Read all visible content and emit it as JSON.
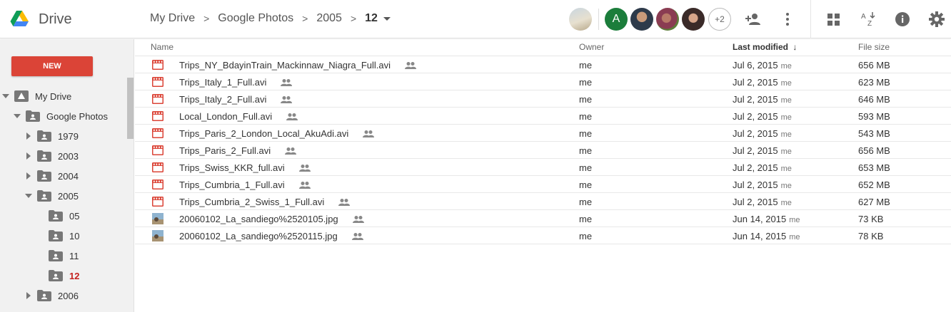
{
  "app": {
    "name": "Drive"
  },
  "breadcrumb": [
    "My Drive",
    "Google Photos",
    "2005",
    "12"
  ],
  "collaborators": {
    "letter": "A",
    "more": "+2"
  },
  "sidebar": {
    "new_label": "NEW",
    "tree": [
      {
        "label": "My Drive",
        "level": 0,
        "expanded": true,
        "type": "drive"
      },
      {
        "label": "Google Photos",
        "level": 1,
        "expanded": true,
        "type": "shared"
      },
      {
        "label": "1979",
        "level": 2,
        "expanded": false,
        "type": "shared"
      },
      {
        "label": "2003",
        "level": 2,
        "expanded": false,
        "type": "shared"
      },
      {
        "label": "2004",
        "level": 2,
        "expanded": false,
        "type": "shared"
      },
      {
        "label": "2005",
        "level": 2,
        "expanded": true,
        "type": "shared"
      },
      {
        "label": "05",
        "level": 3,
        "expanded": null,
        "type": "shared"
      },
      {
        "label": "10",
        "level": 3,
        "expanded": null,
        "type": "shared"
      },
      {
        "label": "11",
        "level": 3,
        "expanded": null,
        "type": "shared"
      },
      {
        "label": "12",
        "level": 3,
        "expanded": null,
        "type": "shared",
        "active": true
      },
      {
        "label": "2006",
        "level": 2,
        "expanded": false,
        "type": "shared"
      }
    ]
  },
  "columns": {
    "name": "Name",
    "owner": "Owner",
    "modified": "Last modified",
    "sort_arrow": "↓",
    "size": "File size"
  },
  "files": [
    {
      "name": "Trips_NY_BdayinTrain_Mackinnaw_Niagra_Full.avi",
      "type": "video",
      "owner": "me",
      "modified": "Jul 6, 2015",
      "modified_by": "me",
      "size": "656 MB"
    },
    {
      "name": "Trips_Italy_1_Full.avi",
      "type": "video",
      "owner": "me",
      "modified": "Jul 2, 2015",
      "modified_by": "me",
      "size": "623 MB"
    },
    {
      "name": "Trips_Italy_2_Full.avi",
      "type": "video",
      "owner": "me",
      "modified": "Jul 2, 2015",
      "modified_by": "me",
      "size": "646 MB"
    },
    {
      "name": "Local_London_Full.avi",
      "type": "video",
      "owner": "me",
      "modified": "Jul 2, 2015",
      "modified_by": "me",
      "size": "593 MB"
    },
    {
      "name": "Trips_Paris_2_London_Local_AkuAdi.avi",
      "type": "video",
      "owner": "me",
      "modified": "Jul 2, 2015",
      "modified_by": "me",
      "size": "543 MB"
    },
    {
      "name": "Trips_Paris_2_Full.avi",
      "type": "video",
      "owner": "me",
      "modified": "Jul 2, 2015",
      "modified_by": "me",
      "size": "656 MB"
    },
    {
      "name": "Trips_Swiss_KKR_full.avi",
      "type": "video",
      "owner": "me",
      "modified": "Jul 2, 2015",
      "modified_by": "me",
      "size": "653 MB"
    },
    {
      "name": "Trips_Cumbria_1_Full.avi",
      "type": "video",
      "owner": "me",
      "modified": "Jul 2, 2015",
      "modified_by": "me",
      "size": "652 MB"
    },
    {
      "name": "Trips_Cumbria_2_Swiss_1_Full.avi",
      "type": "video",
      "owner": "me",
      "modified": "Jul 2, 2015",
      "modified_by": "me",
      "size": "627 MB"
    },
    {
      "name": "20060102_La_sandiego%2520105.jpg",
      "type": "image",
      "owner": "me",
      "modified": "Jun 14, 2015",
      "modified_by": "me",
      "size": "73 KB"
    },
    {
      "name": "20060102_La_sandiego%2520115.jpg",
      "type": "image",
      "owner": "me",
      "modified": "Jun 14, 2015",
      "modified_by": "me",
      "size": "78 KB"
    }
  ],
  "colors": {
    "accent": "#db4437",
    "active_folder": "#c5221f",
    "video_icon": "#db4437"
  },
  "icons": [
    "drive-logo-icon",
    "add-person-icon",
    "more-vert-icon",
    "grid-view-icon",
    "sort-az-icon",
    "info-icon",
    "settings-icon",
    "shared-people-icon",
    "video-file-icon",
    "image-file-icon",
    "folder-shared-icon"
  ]
}
